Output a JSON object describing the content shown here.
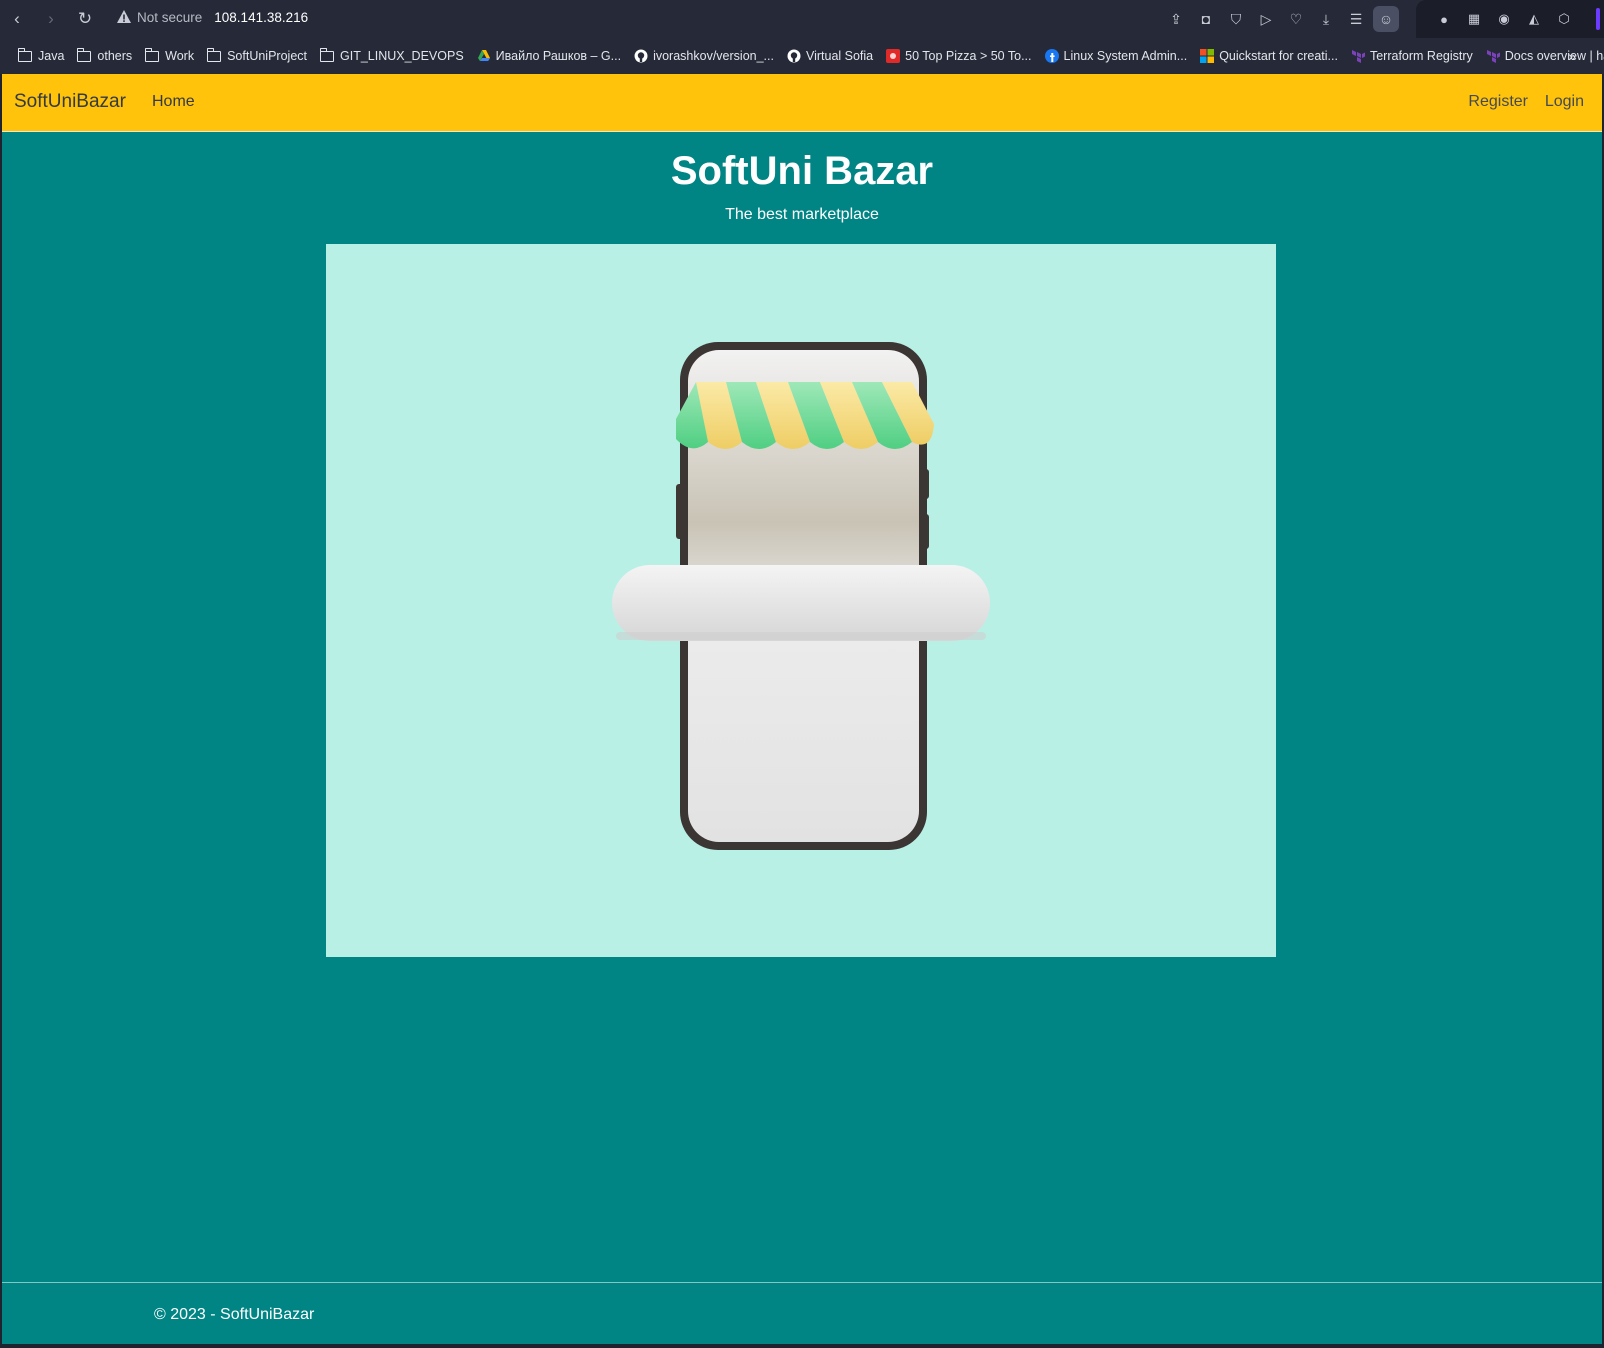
{
  "browser": {
    "not_secure": "Not secure",
    "url": "108.141.38.216",
    "bookmarks": [
      {
        "label": "Java",
        "type": "folder"
      },
      {
        "label": "others",
        "type": "folder"
      },
      {
        "label": "Work",
        "type": "folder"
      },
      {
        "label": "SoftUniProject",
        "type": "folder"
      },
      {
        "label": "GIT_LINUX_DEVOPS",
        "type": "folder"
      },
      {
        "label": "Ивайло Рашков – G...",
        "type": "drive-icon"
      },
      {
        "label": "ivorashkov/version_...",
        "type": "github-icon"
      },
      {
        "label": "Virtual Sofia",
        "type": "github-icon"
      },
      {
        "label": "50 Top Pizza > 50 To...",
        "type": "pizza-icon"
      },
      {
        "label": "Linux System Admin...",
        "type": "facebook-icon"
      },
      {
        "label": "Quickstart for creati...",
        "type": "microsoft-icon"
      },
      {
        "label": "Terraform Registry",
        "type": "terraform-icon"
      },
      {
        "label": "Docs overview | has...",
        "type": "terraform-icon"
      }
    ]
  },
  "navbar": {
    "brand": "SoftUniBazar",
    "home": "Home",
    "register": "Register",
    "login": "Login",
    "background": "#ffc30b"
  },
  "hero": {
    "title": "SoftUni Bazar",
    "subtitle": "The best marketplace"
  },
  "footer": {
    "text": "© 2023 - SoftUniBazar"
  },
  "colors": {
    "page_background": "#008484",
    "image_background": "#b9f0e6",
    "awning_green": "#5fd88f",
    "awning_yellow": "#f2d97a"
  }
}
